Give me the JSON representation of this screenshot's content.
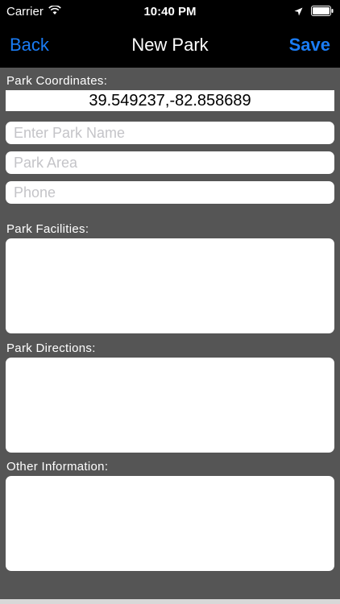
{
  "status_bar": {
    "carrier": "Carrier",
    "time": "10:40 PM"
  },
  "nav": {
    "back_label": "Back",
    "title": "New Park",
    "save_label": "Save",
    "accent_color": "#1a7cf5"
  },
  "form": {
    "coordinates_label": "Park Coordinates:",
    "coordinates_value": "39.549237,-82.858689",
    "park_name_placeholder": "Enter Park Name",
    "park_area_placeholder": "Park Area",
    "phone_placeholder": "Phone",
    "facilities_label": "Park Facilities:",
    "directions_label": "Park Directions:",
    "other_label": "Other Information:"
  },
  "icons": {
    "wifi": "wifi-icon",
    "location": "location-arrow-icon",
    "battery": "battery-icon"
  },
  "colors": {
    "background": "#555555",
    "bar": "#000000",
    "field": "#ffffff",
    "placeholder": "#c4c4c8"
  }
}
